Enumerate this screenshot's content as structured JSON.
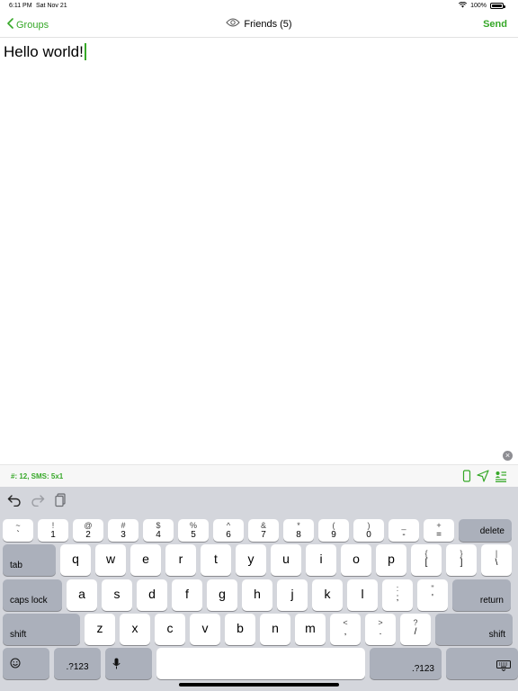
{
  "status_bar": {
    "time": "6:11 PM",
    "date": "Sat Nov 21",
    "battery": "100%"
  },
  "nav": {
    "back_label": "Groups",
    "title": "Friends (5)",
    "send_label": "Send"
  },
  "message": {
    "text": "Hello world!"
  },
  "info_bar": {
    "count_text": "#: 12, SMS: 5x1"
  },
  "colors": {
    "accent": "#36a828",
    "keyboard_bg": "#d4d6dc",
    "key_bg": "#ffffff",
    "modifier_key_bg": "#abb0bb"
  },
  "icons": {
    "back": "chevron-left-icon",
    "eye": "eye-icon",
    "undo": "undo-icon",
    "redo": "redo-icon",
    "paste": "paste-icon",
    "phone": "phone-icon",
    "location": "location-arrow-icon",
    "contact": "contact-card-icon",
    "clear": "clear-icon",
    "emoji": "emoji-icon",
    "mic": "microphone-icon",
    "hide_keyboard": "keyboard-hide-icon"
  },
  "keyboard": {
    "number_row": [
      {
        "top": "~",
        "bottom": "`"
      },
      {
        "top": "!",
        "bottom": "1"
      },
      {
        "top": "@",
        "bottom": "2"
      },
      {
        "top": "#",
        "bottom": "3"
      },
      {
        "top": "$",
        "bottom": "4"
      },
      {
        "top": "%",
        "bottom": "5"
      },
      {
        "top": "^",
        "bottom": "6"
      },
      {
        "top": "&",
        "bottom": "7"
      },
      {
        "top": "*",
        "bottom": "8"
      },
      {
        "top": "(",
        "bottom": "9"
      },
      {
        "top": ")",
        "bottom": "0"
      },
      {
        "top": "_",
        "bottom": "-"
      },
      {
        "top": "+",
        "bottom": "="
      }
    ],
    "delete_label": "delete",
    "tab_label": "tab",
    "row1": [
      "q",
      "w",
      "e",
      "r",
      "t",
      "y",
      "u",
      "i",
      "o",
      "p"
    ],
    "row1_symbols": [
      {
        "top": "{",
        "bottom": "["
      },
      {
        "top": "}",
        "bottom": "]"
      },
      {
        "top": "|",
        "bottom": "\\"
      }
    ],
    "caps_label": "caps lock",
    "row2": [
      "a",
      "s",
      "d",
      "f",
      "g",
      "h",
      "j",
      "k",
      "l"
    ],
    "row2_symbols": [
      {
        "top": ":",
        "bottom": ";"
      },
      {
        "top": "\"",
        "bottom": "'"
      }
    ],
    "return_label": "return",
    "shift_label": "shift",
    "row3": [
      "z",
      "x",
      "c",
      "v",
      "b",
      "n",
      "m"
    ],
    "row3_symbols": [
      {
        "top": "<",
        "bottom": ","
      },
      {
        "top": ">",
        "bottom": "."
      },
      {
        "top": "?",
        "bottom": "/"
      }
    ],
    "numbers_label": ".?123"
  }
}
